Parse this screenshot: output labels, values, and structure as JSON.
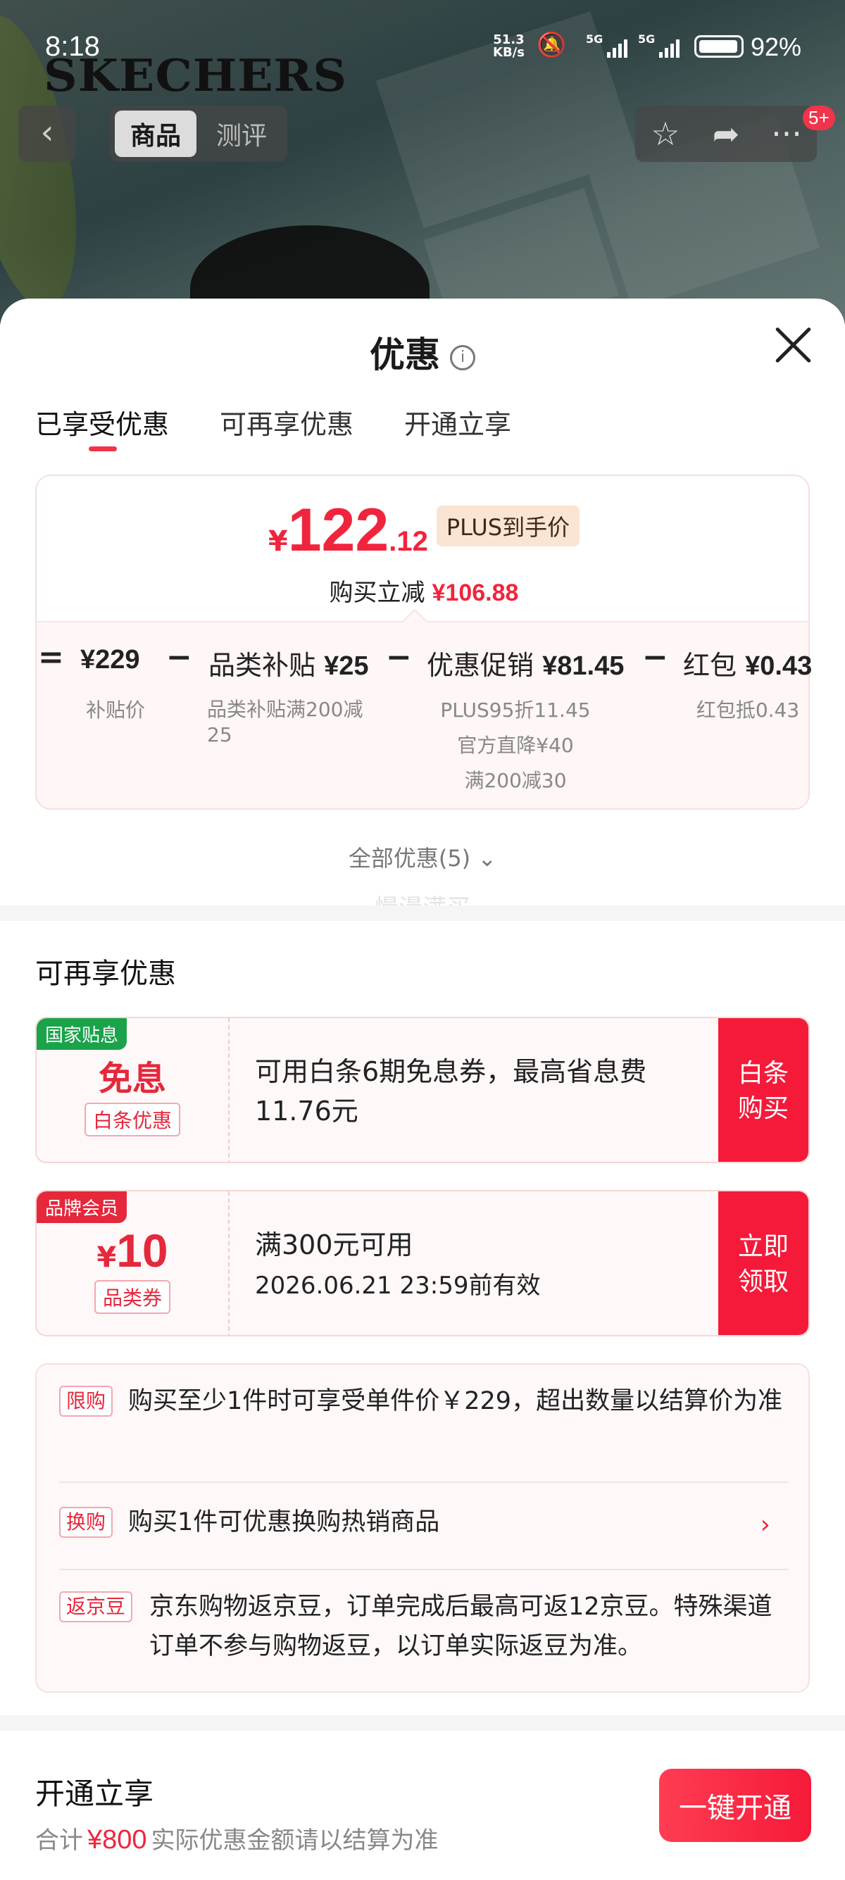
{
  "status_bar": {
    "time": "8:18",
    "net_speed_value": "51.3",
    "net_speed_unit": "KB/s",
    "signal_1": "5G",
    "signal_2": "5G",
    "battery": "92%"
  },
  "brand": "SKECHERS",
  "top_nav": {
    "tabs": [
      "商品",
      "测评"
    ],
    "active_tab": "商品",
    "more_badge": "5+"
  },
  "sheet": {
    "title": "优惠",
    "tabs": [
      "已享受优惠",
      "可再享优惠",
      "开通立享"
    ],
    "active_tab": "已享受优惠"
  },
  "price_card": {
    "currency": "¥",
    "price_integer": "122",
    "price_decimal": ".12",
    "plus_tag": "PLUS到手价",
    "reduce_label": "购买立减",
    "reduce_amount": "¥106.88",
    "breakdown": [
      {
        "op": "=",
        "label": "",
        "amount": "¥229",
        "details": [
          "补贴价"
        ]
      },
      {
        "op": "−",
        "label": "品类补贴",
        "amount": "¥25",
        "details": [
          "品类补贴满200减",
          "25"
        ]
      },
      {
        "op": "−",
        "label": "优惠促销",
        "amount": "¥81.45",
        "details": [
          "PLUS95折11.45",
          "官方直降¥40",
          "满200减30"
        ]
      },
      {
        "op": "−",
        "label": "红包",
        "amount": "¥0.43",
        "details": [
          "红包抵0.43"
        ]
      }
    ]
  },
  "all_offers": "全部优惠(5)",
  "watermark": "慢漫满买",
  "more_offers": {
    "title": "可再享优惠",
    "coupons": [
      {
        "tag": "国家贴息",
        "tag_color": "#1aa34a",
        "headline": "免息",
        "chip": "白条优惠",
        "desc": "可用白条6期免息券，最高省息费11.76元",
        "cta": "白条购买"
      },
      {
        "tag": "品牌会员",
        "tag_color": "#e5283c",
        "yen": "¥",
        "amount": "10",
        "chip": "品类券",
        "desc_line1": "满300元可用",
        "desc_line2": "2026.06.21 23:59前有效",
        "cta": "立即领取"
      }
    ],
    "rules": [
      {
        "pill": "限购",
        "text": "购买至少1件时可享受单件价￥229，超出数量以结算价为准"
      },
      {
        "pill": "换购",
        "text": "购买1件可优惠换购热销商品"
      },
      {
        "pill": "返京豆",
        "text": "京东购物返京豆，订单完成后最高可返12京豆。特殊渠道订单不参与购物返豆，以订单实际返豆为准。"
      }
    ]
  },
  "open_section": {
    "title": "开通立享",
    "sum_label": "合计",
    "sum_amount": "¥800",
    "sum_note": "实际优惠金额请以结算为准",
    "button": "一键开通"
  },
  "colors": {
    "accent": "#f0253d",
    "cta": "#f51a39"
  }
}
